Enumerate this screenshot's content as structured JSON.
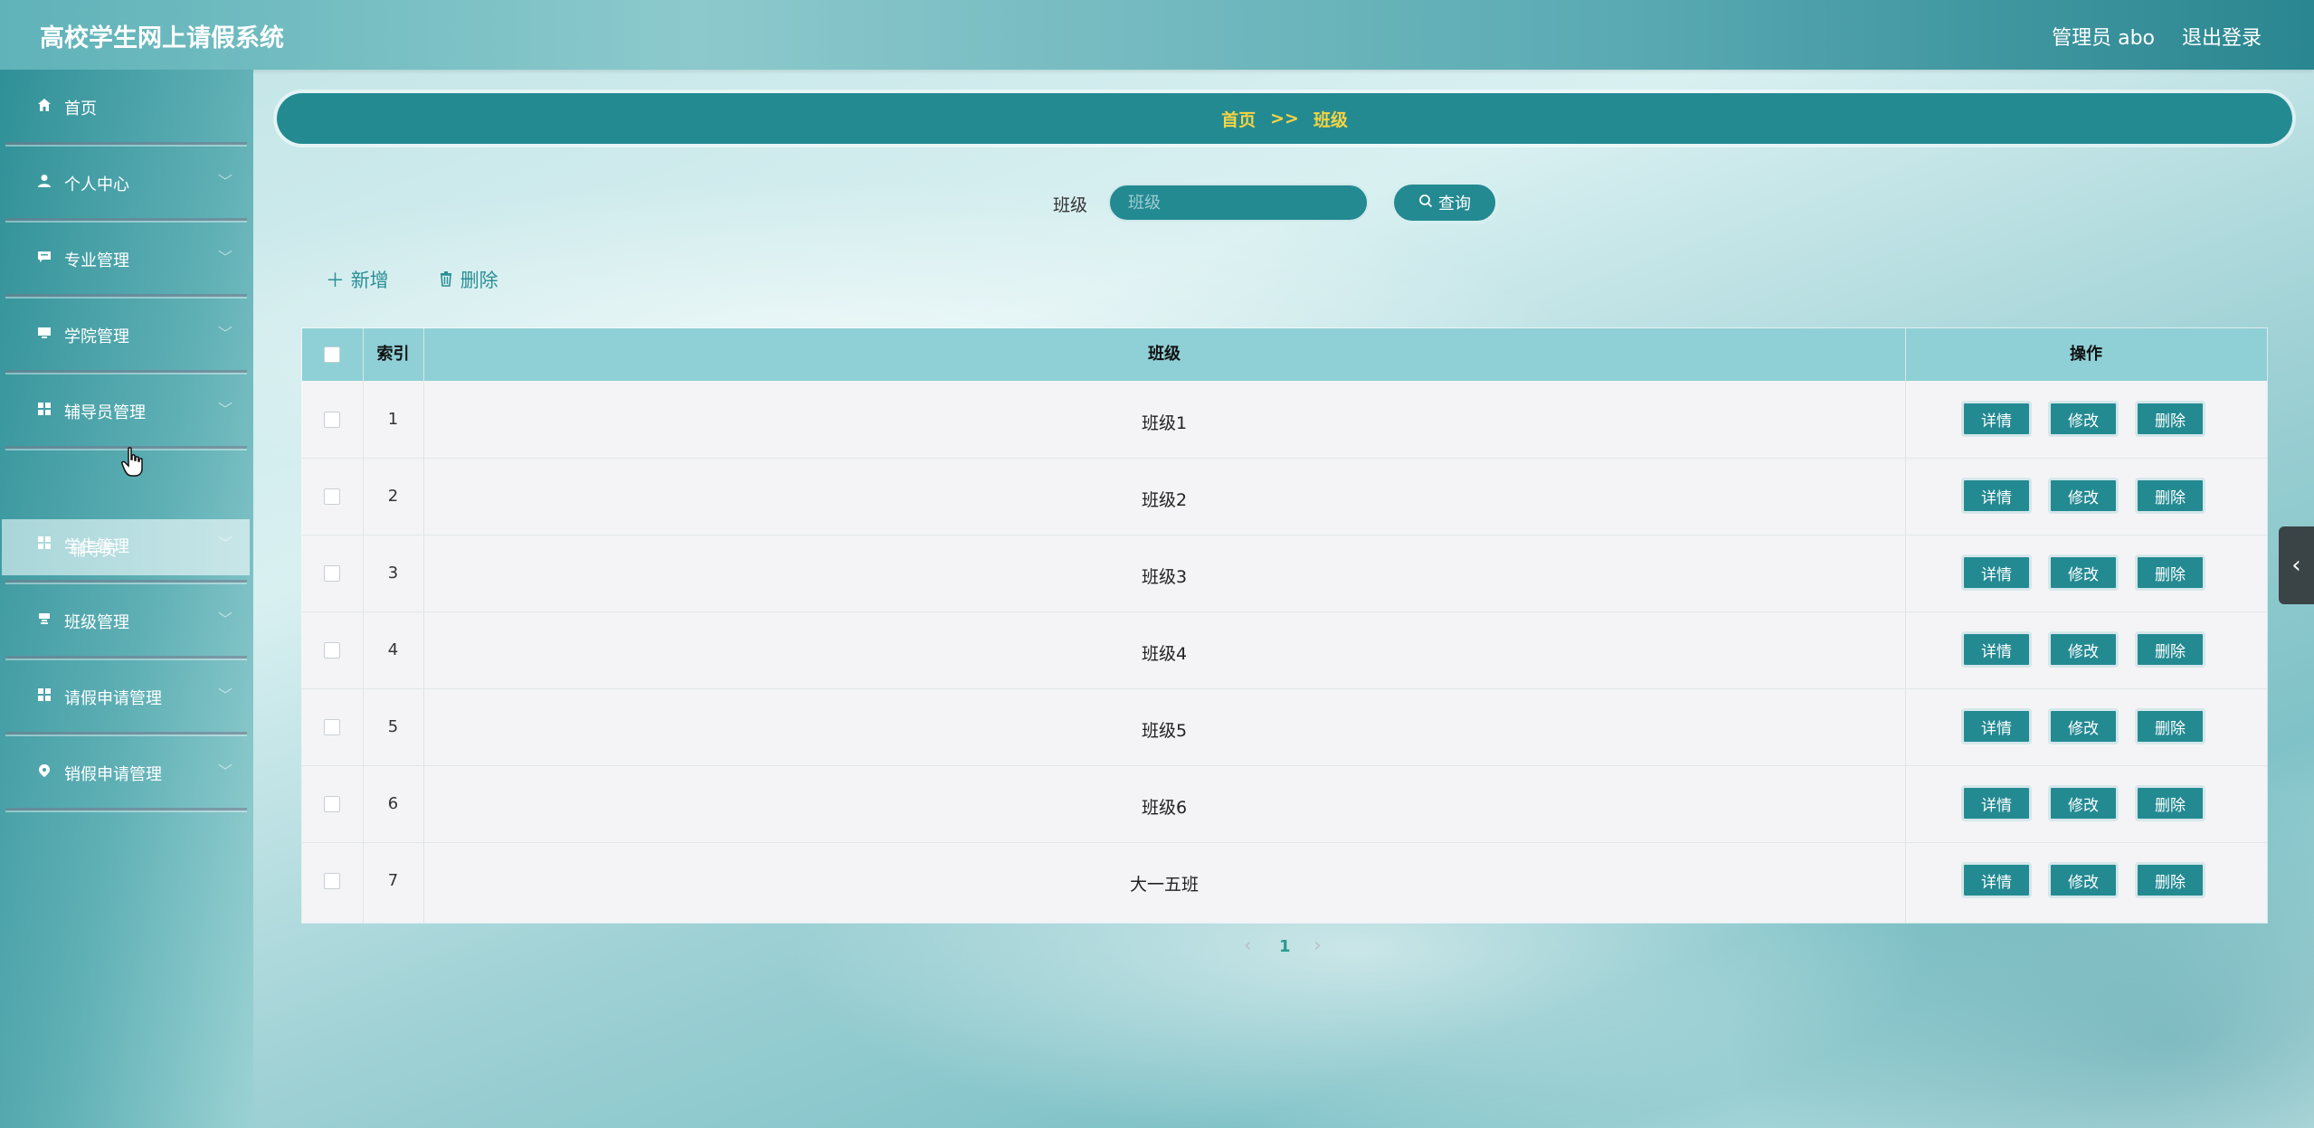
{
  "header": {
    "title": "高校学生网上请假系统",
    "user": "管理员 abo",
    "logout": "退出登录"
  },
  "sidebar": {
    "items": [
      {
        "label": "首页",
        "icon": "home-icon"
      },
      {
        "label": "个人中心",
        "icon": "user-icon"
      },
      {
        "label": "专业管理",
        "icon": "chat-icon"
      },
      {
        "label": "学院管理",
        "icon": "monitor-icon"
      },
      {
        "label": "辅导员管理",
        "icon": "grid-icon"
      },
      {
        "label": "学生管理",
        "icon": "grid-icon"
      },
      {
        "label": "班级管理",
        "icon": "cup-icon"
      },
      {
        "label": "请假申请管理",
        "icon": "grid-icon"
      },
      {
        "label": "销假申请管理",
        "icon": "location-icon"
      }
    ],
    "submenu": {
      "label": "辅导员"
    }
  },
  "breadcrumb": {
    "home": "首页",
    "separator": ">>",
    "current": "班级"
  },
  "search": {
    "label": "班级",
    "placeholder": "班级",
    "value": "",
    "button": "查询"
  },
  "actions": {
    "add": "新增",
    "delete": "删除"
  },
  "table": {
    "headers": {
      "index": "索引",
      "name": "班级",
      "ops": "操作"
    },
    "buttons": {
      "detail": "详情",
      "edit": "修改",
      "delete": "删除"
    },
    "rows": [
      {
        "index": "1",
        "name": "班级1"
      },
      {
        "index": "2",
        "name": "班级2"
      },
      {
        "index": "3",
        "name": "班级3"
      },
      {
        "index": "4",
        "name": "班级4"
      },
      {
        "index": "5",
        "name": "班级5"
      },
      {
        "index": "6",
        "name": "班级6"
      },
      {
        "index": "7",
        "name": "大一五班"
      }
    ]
  },
  "pagination": {
    "prev": "‹",
    "page": "1",
    "next": "›"
  },
  "side_tab": {
    "icon": "chevron-left-icon",
    "glyph": "‹"
  },
  "colors": {
    "primary": "#238a92",
    "header_bg": "#8ed0d6",
    "breadcrumb_text": "#f5d442"
  }
}
